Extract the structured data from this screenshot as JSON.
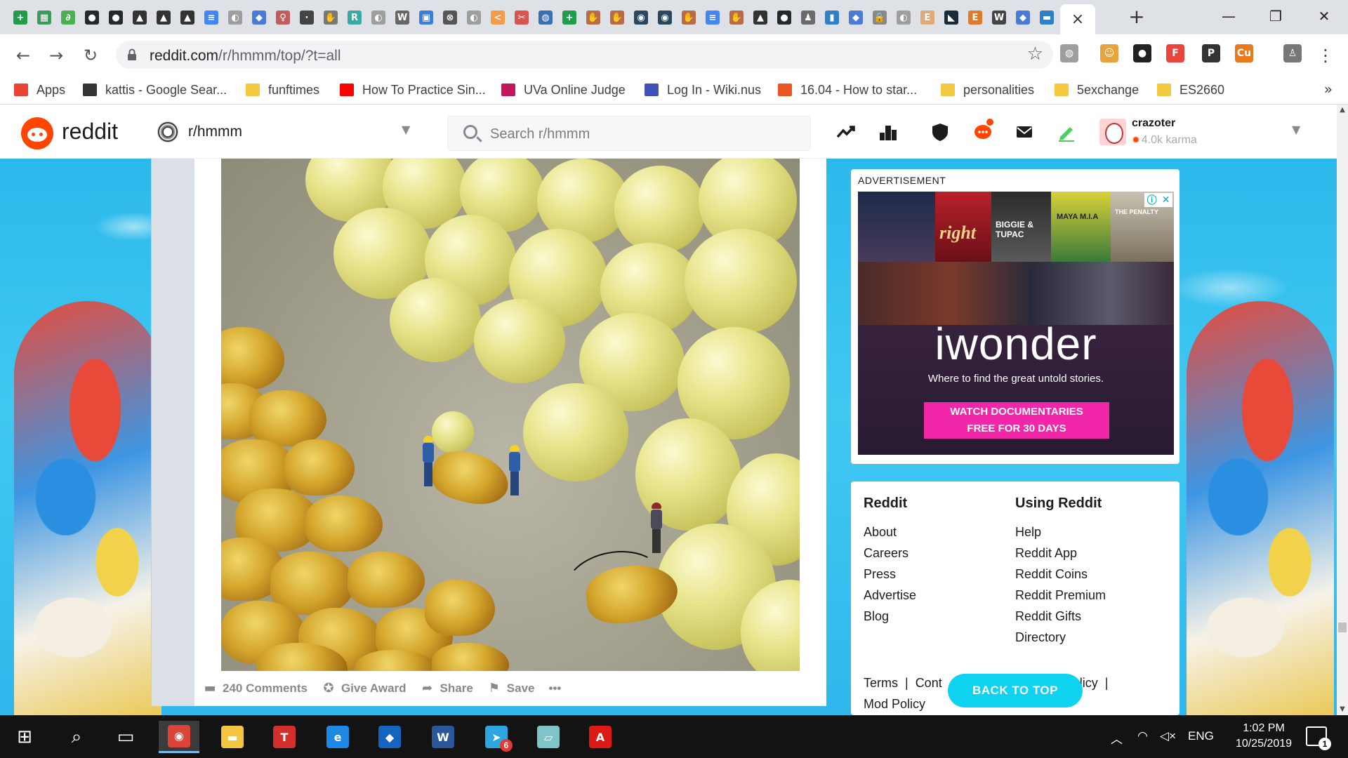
{
  "browser": {
    "tab_favicons": [
      {
        "icon": "green-plus-icon",
        "color": "#1e9e4a",
        "glyph": "+"
      },
      {
        "icon": "sheets-icon",
        "color": "#3a9b5c",
        "glyph": "▦"
      },
      {
        "icon": "leaf-icon",
        "color": "#4caf50",
        "glyph": "∂"
      },
      {
        "icon": "github-icon",
        "color": "#24292e",
        "glyph": "●"
      },
      {
        "icon": "github-icon",
        "color": "#24292e",
        "glyph": "●"
      },
      {
        "icon": "graduation-cap-icon",
        "color": "#333333",
        "glyph": "▲"
      },
      {
        "icon": "graduation-cap-icon",
        "color": "#333333",
        "glyph": "▲"
      },
      {
        "icon": "graduation-cap-icon",
        "color": "#333333",
        "glyph": "▲"
      },
      {
        "icon": "doc-icon",
        "color": "#4285f4",
        "glyph": "≡"
      },
      {
        "icon": "globe-icon",
        "color": "#9e9e9e",
        "glyph": "◐"
      },
      {
        "icon": "blue-diamond-icon",
        "color": "#4a7bd6",
        "glyph": "◆"
      },
      {
        "icon": "figure-icon",
        "color": "#c25b5b",
        "glyph": "♀"
      },
      {
        "icon": "dots-icon",
        "color": "#444444",
        "glyph": "∙"
      },
      {
        "icon": "hand-icon",
        "color": "#777777",
        "glyph": "✋"
      },
      {
        "icon": "r-icon",
        "color": "#3aa9a0",
        "glyph": "R"
      },
      {
        "icon": "globe-icon",
        "color": "#9e9e9e",
        "glyph": "◐"
      },
      {
        "icon": "wikipedia-icon",
        "color": "#666666",
        "glyph": "W"
      },
      {
        "icon": "grid-icon",
        "color": "#3c7dd9",
        "glyph": "▣"
      },
      {
        "icon": "x-circle-icon",
        "color": "#555555",
        "glyph": "⊗"
      },
      {
        "icon": "globe-icon",
        "color": "#9e9e9e",
        "glyph": "◐"
      },
      {
        "icon": "brackets-icon",
        "color": "#f39c4a",
        "glyph": "<"
      },
      {
        "icon": "scissors-icon",
        "color": "#d9534f",
        "glyph": "✂"
      },
      {
        "icon": "ball-icon",
        "color": "#3a6fb5",
        "glyph": "◍"
      },
      {
        "icon": "green-plus-icon",
        "color": "#1e9e4a",
        "glyph": "+"
      },
      {
        "icon": "hand-icon",
        "color": "#b86b4a",
        "glyph": "✋"
      },
      {
        "icon": "hand-icon",
        "color": "#b86b4a",
        "glyph": "✋"
      },
      {
        "icon": "steam-icon",
        "color": "#2a475e",
        "glyph": "◉"
      },
      {
        "icon": "steam-icon",
        "color": "#2a475e",
        "glyph": "◉"
      },
      {
        "icon": "hand-icon",
        "color": "#b86b4a",
        "glyph": "✋"
      },
      {
        "icon": "doc-icon",
        "color": "#4285f4",
        "glyph": "≡"
      },
      {
        "icon": "hand-icon",
        "color": "#b86b4a",
        "glyph": "✋"
      },
      {
        "icon": "graduation-cap-icon",
        "color": "#333333",
        "glyph": "▲"
      },
      {
        "icon": "github-icon",
        "color": "#24292e",
        "glyph": "●"
      },
      {
        "icon": "figure-icon",
        "color": "#6b6b6b",
        "glyph": "♟"
      },
      {
        "icon": "chart-icon",
        "color": "#2f80c9",
        "glyph": "▮"
      },
      {
        "icon": "blue-diamond-icon",
        "color": "#4a7bd6",
        "glyph": "◆"
      },
      {
        "icon": "lock-icon",
        "color": "#888888",
        "glyph": "🔒"
      },
      {
        "icon": "globe-icon",
        "color": "#9e9e9e",
        "glyph": "◐"
      },
      {
        "icon": "e-icon",
        "color": "#e0a97a",
        "glyph": "E"
      },
      {
        "icon": "triangle-icon",
        "color": "#1a2a3a",
        "glyph": "◣"
      },
      {
        "icon": "e-icon",
        "color": "#e07a2a",
        "glyph": "E"
      },
      {
        "icon": "wikipedia-icon",
        "color": "#444444",
        "glyph": "W"
      },
      {
        "icon": "blue-diamond-icon",
        "color": "#4a7bd6",
        "glyph": "◆"
      },
      {
        "icon": "box-icon",
        "color": "#2f7fc9",
        "glyph": "▬"
      },
      {
        "icon": "ieee-icon",
        "color": "#1b4a8a",
        "glyph": "Ⅲ"
      }
    ],
    "active_tab_close": "×",
    "new_tab": "+",
    "window_controls": {
      "minimize": "—",
      "maximize": "❐",
      "close": "✕"
    },
    "url_host": "reddit.com",
    "url_path": "/r/hmmm/top/?t=all",
    "extensions": [
      {
        "icon": "globe-extension-icon",
        "color": "#9e9e9e",
        "glyph": "◍"
      },
      {
        "icon": "face-extension-icon",
        "color": "#e8a33d",
        "glyph": "☺"
      },
      {
        "icon": "mask-extension-icon",
        "color": "#222222",
        "glyph": "●"
      },
      {
        "icon": "f-extension-icon",
        "color": "#e8453c",
        "glyph": "F"
      },
      {
        "icon": "p-extension-icon",
        "color": "#333333",
        "glyph": "P"
      },
      {
        "icon": "cu-extension-icon",
        "color": "#e87a1e",
        "glyph": "Cu"
      },
      {
        "icon": "person-extension-icon",
        "color": "#777777",
        "glyph": "♙"
      }
    ],
    "bookmarks": [
      {
        "label": "Apps",
        "icon": "apps-grid-icon",
        "color": "#ea4335"
      },
      {
        "label": "kattis - Google Sear...",
        "icon": "kattis-icon",
        "color": "#333333"
      },
      {
        "label": "funftimes",
        "icon": "folder-icon",
        "color": "#f5c841"
      },
      {
        "label": "How To Practice Sin...",
        "icon": "youtube-icon",
        "color": "#ff0000"
      },
      {
        "label": "UVa Online Judge",
        "icon": "uva-icon",
        "color": "#c2185b"
      },
      {
        "label": "Log In - Wiki.nus",
        "icon": "nus-icon",
        "color": "#3f51b5"
      },
      {
        "label": "16.04 - How to star...",
        "icon": "askubuntu-icon",
        "color": "#e95420"
      },
      {
        "label": "personalities",
        "icon": "folder-icon",
        "color": "#f5c841"
      },
      {
        "label": "5exchange",
        "icon": "folder-icon",
        "color": "#f5c841"
      },
      {
        "label": "ES2660",
        "icon": "folder-icon",
        "color": "#f5c841"
      }
    ],
    "bookmarks_more": "»"
  },
  "reddit": {
    "wordmark": "reddit",
    "subreddit": "r/hmmm",
    "search_placeholder": "Search r/hmmm",
    "username": "crazoter",
    "karma": "4.0k karma"
  },
  "post": {
    "actions": [
      {
        "label": "240 Comments",
        "icon": "comment-icon",
        "glyph": "▬"
      },
      {
        "label": "Give Award",
        "icon": "award-icon",
        "glyph": "✪"
      },
      {
        "label": "Share",
        "icon": "share-icon",
        "glyph": "➦"
      },
      {
        "label": "Save",
        "icon": "bookmark-icon",
        "glyph": "⚑"
      }
    ],
    "more": "•••"
  },
  "ad": {
    "label": "ADVERTISEMENT",
    "brand": "iwonder",
    "tagline": "Where to find the great untold stories.",
    "cta_line1": "WATCH DOCUMENTARIES",
    "cta_line2": "FREE FOR 30 DAYS",
    "poster_texts": [
      "right",
      "BIGGIE & TUPAC",
      "MAYA M.I.A",
      "THE PENALTY"
    ]
  },
  "footer": {
    "col1_title": "Reddit",
    "col1_links": [
      "About",
      "Careers",
      "Press",
      "Advertise",
      "Blog"
    ],
    "col2_title": "Using Reddit",
    "col2_links": [
      "Help",
      "Reddit App",
      "Reddit Coins",
      "Reddit Premium",
      "Reddit Gifts",
      "Directory"
    ],
    "terms": "Terms",
    "sep": "|",
    "content_partial": "Cont",
    "policy_partial": "olicy",
    "mod_policy": "Mod Policy",
    "back_to_top": "BACK TO TOP"
  },
  "taskbar": {
    "apps": [
      {
        "icon": "windows-start-icon",
        "color": "#ffffff"
      },
      {
        "icon": "search-icon",
        "color": "#ffffff"
      },
      {
        "icon": "task-view-icon",
        "color": "#ffffff"
      },
      {
        "icon": "chrome-icon",
        "color": "#db4437"
      },
      {
        "icon": "file-explorer-icon",
        "color": "#f4c542"
      },
      {
        "icon": "t-app-icon",
        "color": "#d32f2f"
      },
      {
        "icon": "edge-icon",
        "color": "#1e88e5"
      },
      {
        "icon": "maps-icon",
        "color": "#1565c0"
      },
      {
        "icon": "word-icon",
        "color": "#2b579a"
      },
      {
        "icon": "telegram-icon",
        "color": "#2ca5e0"
      },
      {
        "icon": "notepad-icon",
        "color": "#7fc4c8"
      },
      {
        "icon": "angular-icon",
        "color": "#dd1b16"
      }
    ],
    "telegram_badge": "6",
    "language": "ENG",
    "time": "1:02 PM",
    "date": "10/25/2019",
    "notifications": "1"
  }
}
